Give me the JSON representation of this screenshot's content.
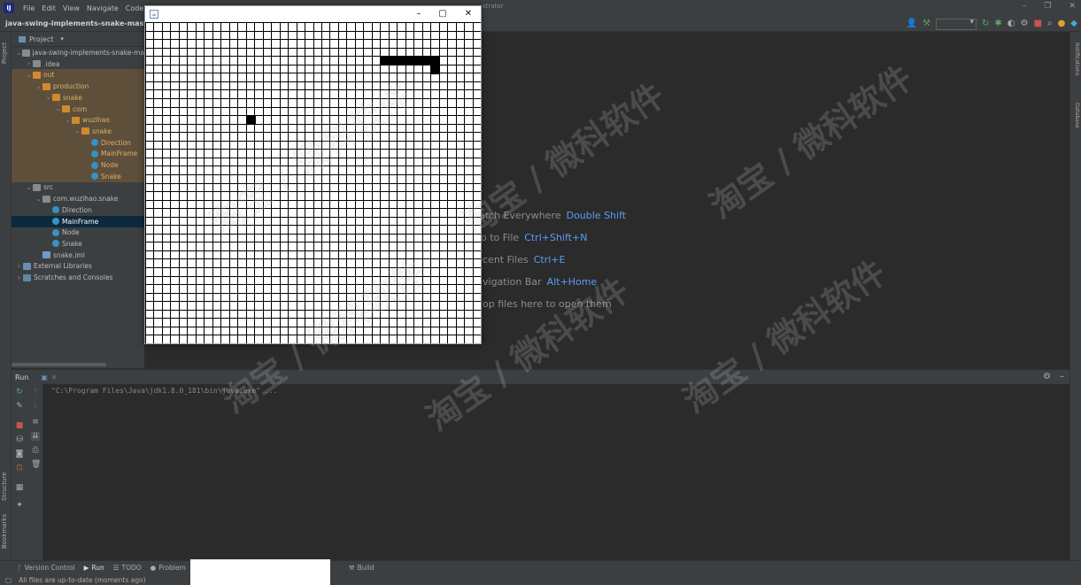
{
  "menubar": {
    "items": [
      "File",
      "Edit",
      "View",
      "Navigate",
      "Code"
    ],
    "title_fragment": "strator"
  },
  "navbar": {
    "project_name": "java-swing-implements-snake-master"
  },
  "project_panel": {
    "header": "Project",
    "tree": [
      {
        "label": "java-swing-implements-snake-ma",
        "depth": 0,
        "arrow": "open",
        "icon": "folder",
        "style": ""
      },
      {
        "label": ".idea",
        "depth": 1,
        "arrow": "closed",
        "icon": "folder",
        "style": ""
      },
      {
        "label": "out",
        "depth": 1,
        "arrow": "open",
        "icon": "folder-orange",
        "style": "excluded"
      },
      {
        "label": "production",
        "depth": 2,
        "arrow": "open",
        "icon": "folder-orange",
        "style": "excluded"
      },
      {
        "label": "snake",
        "depth": 3,
        "arrow": "open",
        "icon": "folder-orange",
        "style": "excluded"
      },
      {
        "label": "com",
        "depth": 4,
        "arrow": "open",
        "icon": "folder-orange",
        "style": "excluded"
      },
      {
        "label": "wuzihao",
        "depth": 5,
        "arrow": "open",
        "icon": "folder-orange",
        "style": "excluded"
      },
      {
        "label": "snake",
        "depth": 6,
        "arrow": "open",
        "icon": "folder-orange",
        "style": "excluded"
      },
      {
        "label": "Direction",
        "depth": 7,
        "arrow": "",
        "icon": "java",
        "style": "excluded"
      },
      {
        "label": "MainFrame",
        "depth": 7,
        "arrow": "",
        "icon": "java",
        "style": "excluded"
      },
      {
        "label": "Node",
        "depth": 7,
        "arrow": "",
        "icon": "java",
        "style": "excluded"
      },
      {
        "label": "Snake",
        "depth": 7,
        "arrow": "",
        "icon": "java",
        "style": "excluded"
      },
      {
        "label": "src",
        "depth": 1,
        "arrow": "open",
        "icon": "folder",
        "style": ""
      },
      {
        "label": "com.wuzihao.snake",
        "depth": 2,
        "arrow": "open",
        "icon": "folder",
        "style": ""
      },
      {
        "label": "Direction",
        "depth": 3,
        "arrow": "",
        "icon": "java",
        "style": ""
      },
      {
        "label": "MainFrame",
        "depth": 3,
        "arrow": "",
        "icon": "java",
        "style": "selected"
      },
      {
        "label": "Node",
        "depth": 3,
        "arrow": "",
        "icon": "java",
        "style": ""
      },
      {
        "label": "Snake",
        "depth": 3,
        "arrow": "",
        "icon": "java",
        "style": ""
      },
      {
        "label": "snake.iml",
        "depth": 2,
        "arrow": "",
        "icon": "iml",
        "style": ""
      },
      {
        "label": "External Libraries",
        "depth": 0,
        "arrow": "closed",
        "icon": "lib",
        "style": ""
      },
      {
        "label": "Scratches and Consoles",
        "depth": 0,
        "arrow": "closed",
        "icon": "scratch",
        "style": ""
      }
    ]
  },
  "stripes": {
    "left_top": "Project",
    "left_bottom": [
      "Structure",
      "Bookmarks"
    ],
    "right": [
      "Notifications",
      "Database"
    ]
  },
  "welcome_hints": [
    {
      "text": "arch Everywhere",
      "key": "Double Shift"
    },
    {
      "text": "o to File",
      "key": "Ctrl+Shift+N"
    },
    {
      "text": "cent Files",
      "key": "Ctrl+E"
    },
    {
      "text": "vigation Bar",
      "key": "Alt+Home"
    },
    {
      "text": "op files here to open them",
      "key": ""
    }
  ],
  "run_panel": {
    "title": "Run",
    "console_line": "\"C:\\Program Files\\Java\\jdk1.8.0_181\\bin\\java.exe\" ..."
  },
  "bottom_tabs": [
    {
      "label": "Version Control",
      "icon": "branch-icon"
    },
    {
      "label": "Run",
      "icon": "play-icon",
      "active": true
    },
    {
      "label": "TODO",
      "icon": "list-icon"
    },
    {
      "label": "Problem",
      "icon": "warning-icon"
    },
    {
      "label": "Build",
      "icon": "hammer-icon"
    }
  ],
  "status": {
    "message": "All files are up-to-date (moments ago)"
  },
  "game": {
    "grid_columns": 40,
    "grid_rows": 38,
    "snake_cells": [
      [
        28,
        4
      ],
      [
        29,
        4
      ],
      [
        30,
        4
      ],
      [
        31,
        4
      ],
      [
        32,
        4
      ],
      [
        33,
        4
      ],
      [
        34,
        4
      ],
      [
        34,
        5
      ]
    ],
    "food_cell": [
      12,
      11
    ],
    "colors": {
      "cell_fill": "#000000",
      "grid_line": "#000000",
      "background": "#ffffff"
    }
  },
  "watermark": {
    "text": "淘宝 / 微科软件"
  }
}
